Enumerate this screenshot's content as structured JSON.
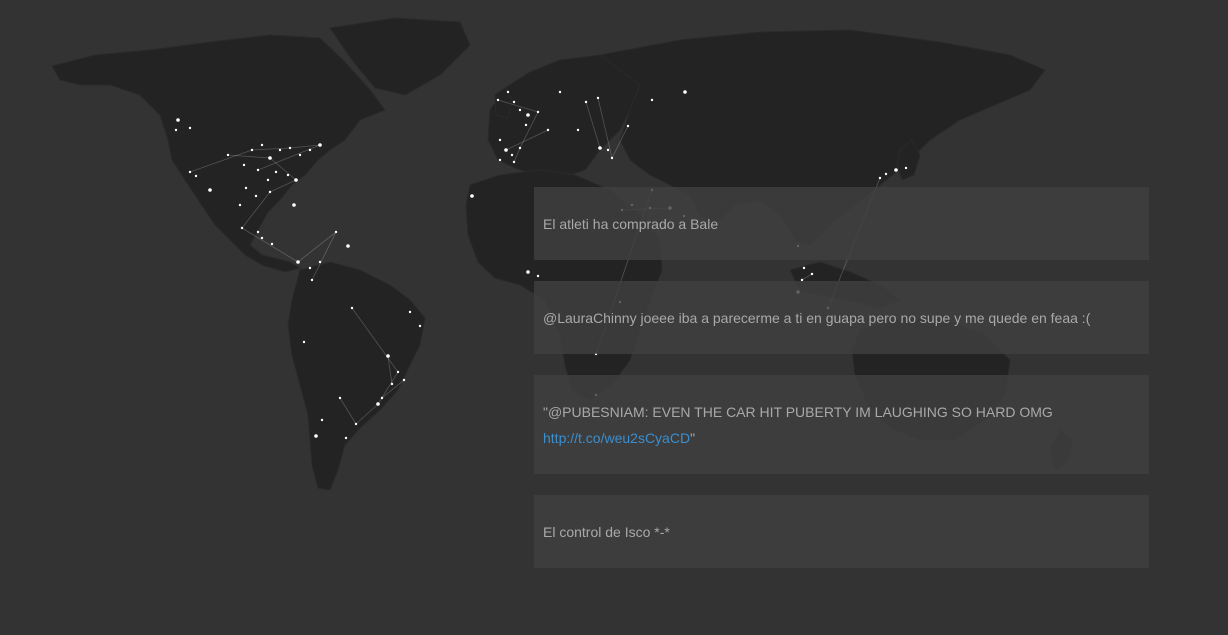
{
  "colors": {
    "background": "#333333",
    "land": "#232323",
    "card": "#404040",
    "text": "#a9a9a9",
    "link": "#3a8fd0",
    "city_dot": "#ffffff"
  },
  "map": {
    "icon": "world-map-icon"
  },
  "tweets": [
    {
      "text": "El atleti ha comprado a Bale"
    },
    {
      "text": "@LauraChinny joeee iba a parecerme a ti en guapa pero no supe y me quede en feaa :("
    },
    {
      "text_before": "\"@PUBESNIAM: EVEN THE CAR HIT PUBERTY IM LAUGHING SO HARD OMG ",
      "link": "http://t.co/weu2sCyaCD",
      "text_after": "\""
    },
    {
      "text": "El control de Isco *-*"
    }
  ]
}
